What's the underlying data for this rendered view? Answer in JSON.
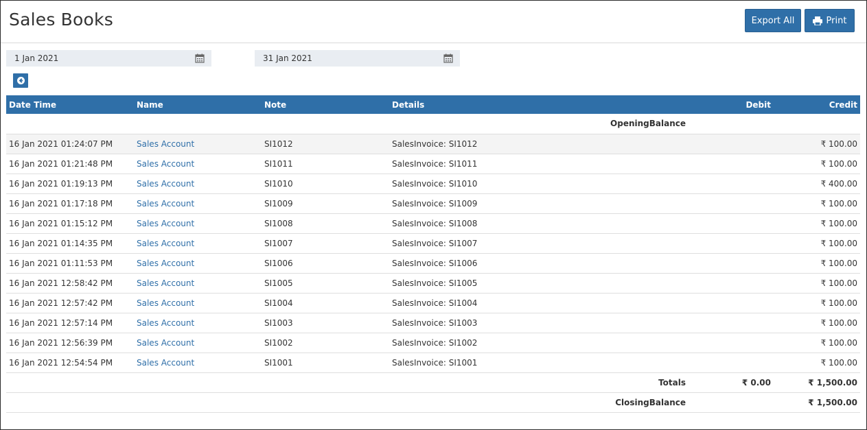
{
  "page": {
    "title": "Sales Books"
  },
  "toolbar": {
    "export_label": "Export All",
    "print_label": "Print"
  },
  "filters": {
    "from_date": "1 Jan 2021",
    "to_date": "31 Jan 2021"
  },
  "table": {
    "headers": {
      "datetime": "Date Time",
      "name": "Name",
      "note": "Note",
      "details": "Details",
      "debit": "Debit",
      "credit": "Credit"
    },
    "opening_label": "OpeningBalance",
    "rows": [
      {
        "datetime": "16 Jan 2021 01:24:07 PM",
        "name": "Sales Account",
        "note": "SI1012",
        "details": "SalesInvoice: SI1012",
        "debit": "",
        "credit": "₹ 100.00"
      },
      {
        "datetime": "16 Jan 2021 01:21:48 PM",
        "name": "Sales Account",
        "note": "SI1011",
        "details": "SalesInvoice: SI1011",
        "debit": "",
        "credit": "₹ 100.00"
      },
      {
        "datetime": "16 Jan 2021 01:19:13 PM",
        "name": "Sales Account",
        "note": "SI1010",
        "details": "SalesInvoice: SI1010",
        "debit": "",
        "credit": "₹ 400.00"
      },
      {
        "datetime": "16 Jan 2021 01:17:18 PM",
        "name": "Sales Account",
        "note": "SI1009",
        "details": "SalesInvoice: SI1009",
        "debit": "",
        "credit": "₹ 100.00"
      },
      {
        "datetime": "16 Jan 2021 01:15:12 PM",
        "name": "Sales Account",
        "note": "SI1008",
        "details": "SalesInvoice: SI1008",
        "debit": "",
        "credit": "₹ 100.00"
      },
      {
        "datetime": "16 Jan 2021 01:14:35 PM",
        "name": "Sales Account",
        "note": "SI1007",
        "details": "SalesInvoice: SI1007",
        "debit": "",
        "credit": "₹ 100.00"
      },
      {
        "datetime": "16 Jan 2021 01:11:53 PM",
        "name": "Sales Account",
        "note": "SI1006",
        "details": "SalesInvoice: SI1006",
        "debit": "",
        "credit": "₹ 100.00"
      },
      {
        "datetime": "16 Jan 2021 12:58:42 PM",
        "name": "Sales Account",
        "note": "SI1005",
        "details": "SalesInvoice: SI1005",
        "debit": "",
        "credit": "₹ 100.00"
      },
      {
        "datetime": "16 Jan 2021 12:57:42 PM",
        "name": "Sales Account",
        "note": "SI1004",
        "details": "SalesInvoice: SI1004",
        "debit": "",
        "credit": "₹ 100.00"
      },
      {
        "datetime": "16 Jan 2021 12:57:14 PM",
        "name": "Sales Account",
        "note": "SI1003",
        "details": "SalesInvoice: SI1003",
        "debit": "",
        "credit": "₹ 100.00"
      },
      {
        "datetime": "16 Jan 2021 12:56:39 PM",
        "name": "Sales Account",
        "note": "SI1002",
        "details": "SalesInvoice: SI1002",
        "debit": "",
        "credit": "₹ 100.00"
      },
      {
        "datetime": "16 Jan 2021 12:54:54 PM",
        "name": "Sales Account",
        "note": "SI1001",
        "details": "SalesInvoice: SI1001",
        "debit": "",
        "credit": "₹ 100.00"
      }
    ],
    "totals": {
      "label": "Totals",
      "debit": "₹ 0.00",
      "credit": "₹ 1,500.00"
    },
    "closing": {
      "label": "ClosingBalance",
      "credit": "₹ 1,500.00"
    }
  },
  "icons": {
    "print": "printer-icon",
    "calendar": "calendar-icon",
    "back": "arrow-left-circle-icon"
  },
  "colors": {
    "accent": "#2f6fa8",
    "header_text": "#ffffff",
    "link": "#2f6fa8"
  }
}
